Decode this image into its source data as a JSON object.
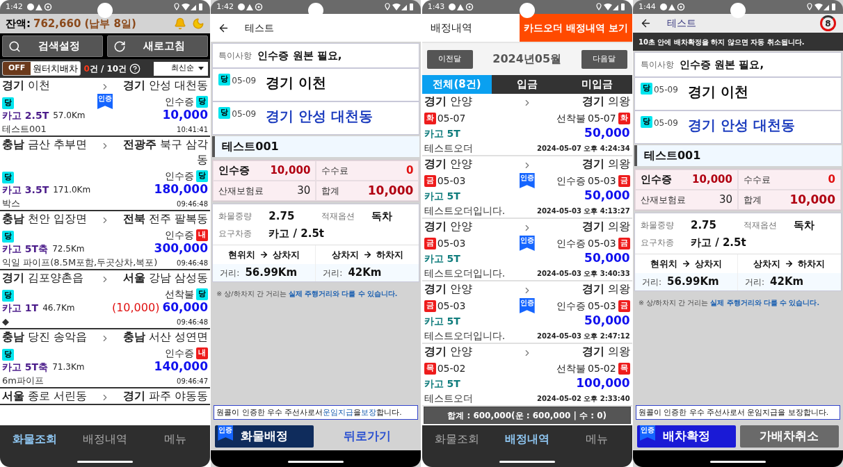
{
  "cargo_list": {
    "status_time": "1:42",
    "balance_label": "잔액:",
    "balance_value": "762,660 (납부 8일)",
    "buttons": [
      {
        "kind": "search",
        "label": "검색설정"
      },
      {
        "kind": "refresh",
        "label": "새로고침"
      }
    ],
    "auto_toggle": {
      "on": false,
      "state_label": "OFF",
      "label": "원터치배차"
    },
    "count": {
      "current": "0",
      "rest": "건 / 10건"
    },
    "sort": "최신순",
    "items": [
      {
        "from_region": "경기",
        "from_place": "이천",
        "to_region": "경기",
        "to_place": "안성 대천동",
        "left_badge": {
          "text": "당",
          "color": "#00e5ee"
        },
        "cert": "인증",
        "pay_type": "인수증",
        "right_badge": {
          "text": "당",
          "color": "#00e5ee"
        },
        "vehicle": "카고 2.5T",
        "distance": "57.0Km",
        "price": "10,000",
        "memo": "테스트001",
        "time": "10:41:41"
      },
      {
        "from_region": "충남",
        "from_place": "금산 추부면",
        "to_region": "전광주",
        "to_place": "북구 삼각동",
        "left_badge": {
          "text": "당",
          "color": "#00e5ee"
        },
        "pay_type": "인수증",
        "right_badge": {
          "text": "당",
          "color": "#00e5ee"
        },
        "vehicle": "카고 3.5T",
        "distance": "171.0Km",
        "price": "180,000",
        "memo": "박스",
        "time": "09:46:48"
      },
      {
        "from_region": "충남",
        "from_place": "천안 입장면",
        "to_region": "전북",
        "to_place": "전주 팔복동",
        "left_badge": {
          "text": "당",
          "color": "#00e5ee"
        },
        "pay_type": "인수증",
        "right_badge": {
          "text": "내",
          "color": "#ee1c1c"
        },
        "vehicle": "카고 5T축",
        "distance": "72.5Km",
        "price": "300,000",
        "memo": "익일 파이프(8.5M포함,두곳상차,복포)",
        "time": "09:46:48"
      },
      {
        "from_region": "경기",
        "from_place": "김포양촌읍",
        "to_region": "서울",
        "to_place": "강남 삼성동",
        "left_badge": {
          "text": "당",
          "color": "#00e5ee"
        },
        "pay_type": "선착불",
        "right_badge": {
          "text": "당",
          "color": "#00e5ee"
        },
        "vehicle": "카고 1T",
        "distance": "46.7Km",
        "fee": "(10,000)",
        "price": "60,000",
        "memo": "◆",
        "time": "09:46:48"
      },
      {
        "from_region": "충남",
        "from_place": "당진 송악읍",
        "to_region": "충남",
        "to_place": "서산 성연면",
        "left_badge": {
          "text": "당",
          "color": "#00e5ee"
        },
        "pay_type": "인수증",
        "right_badge": {
          "text": "내",
          "color": "#ee1c1c"
        },
        "vehicle": "카고 5T축",
        "distance": "71.3Km",
        "price": "140,000",
        "memo": "6m파이프",
        "time": "09:46:47"
      },
      {
        "from_region": "서울",
        "from_place": "종로 서린동",
        "to_region": "경기",
        "to_place": "파주 야동동"
      }
    ],
    "nav": [
      {
        "label": "화물조회",
        "selected": true
      },
      {
        "label": "배정내역",
        "selected": false
      },
      {
        "label": "메뉴",
        "selected": false
      }
    ]
  },
  "detail": {
    "status_time": "1:42",
    "title": "테스트",
    "special_label": "특이사항",
    "special_value": "인수증 원본 필요,",
    "stops": [
      {
        "kind": "pickup",
        "badge": {
          "text": "당",
          "color": "#00e5ee"
        },
        "date": "05-09",
        "place": "경기 이천"
      },
      {
        "kind": "dropoff",
        "badge": {
          "text": "당",
          "color": "#00e5ee"
        },
        "date": "05-09",
        "place": "경기 안성 대천동"
      }
    ],
    "cargo_name": "테스트001",
    "fees": [
      {
        "kind": "fare",
        "label": "인수증",
        "value": "10,000"
      },
      {
        "kind": "commission",
        "label": "수수료",
        "value": "0"
      },
      {
        "kind": "insurance",
        "label": "산재보험료",
        "value": "30"
      },
      {
        "kind": "total",
        "label": "합계",
        "value": "10,000"
      }
    ],
    "info": [
      {
        "label": "화물중량",
        "value": "2.75"
      },
      {
        "label": "적재옵션",
        "value": "독차"
      },
      {
        "label": "요구차종",
        "value": "카고 / 2.5t"
      }
    ],
    "routes": [
      {
        "from": "현위치",
        "to": "상차지",
        "distance_label": "거리:",
        "distance": "56.99Km"
      },
      {
        "from": "상차지",
        "to": "하차지",
        "distance_label": "거리:",
        "distance": "42Km"
      }
    ],
    "note": {
      "text": "※ 상/하차지 간 거리는",
      "highlight": "실제 주행거리와 다를 수 있습니다."
    },
    "guarantee": [
      {
        "text": "원콜이 인증한 우수 주선사로서 ",
        "highlight": false
      },
      {
        "text": "운임지급",
        "highlight": true
      },
      {
        "text": "을 ",
        "highlight": false
      },
      {
        "text": "보장",
        "highlight": true
      },
      {
        "text": "합니다.",
        "highlight": false
      }
    ],
    "buttons": [
      {
        "kind": "assign",
        "label": "화물배정",
        "cert": "인증"
      },
      {
        "kind": "text",
        "label": "뒤로가기"
      }
    ]
  },
  "assignments": {
    "status_time": "1:43",
    "title": "배정내역",
    "card_button": "카드오더 배정내역 보기",
    "prev": "이전달",
    "month": "2024년05월",
    "next": "다음달",
    "tabs": [
      {
        "label": "전체(8건)",
        "selected": true
      },
      {
        "label": "입금",
        "selected": false
      },
      {
        "label": "미입금",
        "selected": false
      }
    ],
    "items": [
      {
        "from_region": "경기",
        "from_place": "안양",
        "to_region": "경기",
        "to_place": "의왕",
        "left_badge": {
          "text": "화",
          "color": "#ee1c1c"
        },
        "date": "05-07",
        "pay_type": "선착불",
        "right_date": "05-07",
        "right_badge": {
          "text": "화",
          "color": "#ee1c1c"
        },
        "vehicle": "카고 5T",
        "price": "50,000",
        "memo": "테스트오더",
        "time": "2024-05-07 오후 4:24:34"
      },
      {
        "from_region": "경기",
        "from_place": "안양",
        "to_region": "경기",
        "to_place": "의왕",
        "left_badge": {
          "text": "금",
          "color": "#ee1c1c"
        },
        "date": "05-03",
        "cert": "인증",
        "pay_type": "인수증",
        "right_date": "05-03",
        "right_badge": {
          "text": "금",
          "color": "#ee1c1c"
        },
        "vehicle": "카고 5T",
        "price": "50,000",
        "memo": "테스트오더입니다.",
        "time": "2024-05-03 오후 4:13:27"
      },
      {
        "from_region": "경기",
        "from_place": "안양",
        "to_region": "경기",
        "to_place": "의왕",
        "left_badge": {
          "text": "금",
          "color": "#ee1c1c"
        },
        "date": "05-03",
        "cert": "인증",
        "pay_type": "인수증",
        "right_date": "05-03",
        "right_badge": {
          "text": "금",
          "color": "#ee1c1c"
        },
        "vehicle": "카고 5T",
        "price": "50,000",
        "memo": "테스트오더입니다.",
        "time": "2024-05-03 오후 3:40:33"
      },
      {
        "from_region": "경기",
        "from_place": "안양",
        "to_region": "경기",
        "to_place": "의왕",
        "left_badge": {
          "text": "금",
          "color": "#ee1c1c"
        },
        "date": "05-03",
        "cert": "인증",
        "pay_type": "인수증",
        "right_date": "05-03",
        "right_badge": {
          "text": "금",
          "color": "#ee1c1c"
        },
        "vehicle": "카고 5T",
        "price": "50,000",
        "memo": "테스트오더입니다.",
        "time": "2024-05-03 오후 2:47:12"
      },
      {
        "from_region": "경기",
        "from_place": "안양",
        "to_region": "경기",
        "to_place": "의왕",
        "left_badge": {
          "text": "목",
          "color": "#ee1c1c"
        },
        "date": "05-02",
        "pay_type": "선착불",
        "right_date": "05-02",
        "right_badge": {
          "text": "목",
          "color": "#ee1c1c"
        },
        "vehicle": "카고 5T",
        "price": "100,000",
        "memo": "테스트오더",
        "time": "2024-05-02 오후 2:33:40"
      }
    ],
    "total": "합계 : 600,000(운 : 600,000 | 수 : 0)",
    "nav": [
      {
        "label": "화물조회",
        "selected": false
      },
      {
        "label": "배정내역",
        "selected": true
      },
      {
        "label": "메뉴",
        "selected": false
      }
    ]
  },
  "confirm": {
    "status_time": "1:44",
    "title": "테스트",
    "countdown": "8",
    "notice": "10초 안에 배차확정을 하지 않으면 자동 취소됩니다.",
    "special_label": "특이사항",
    "special_value": "인수증 원본 필요,",
    "stops": [
      {
        "kind": "pickup",
        "badge": {
          "text": "당",
          "color": "#00e5ee"
        },
        "date": "05-09",
        "place": "경기 이천"
      },
      {
        "kind": "dropoff",
        "badge": {
          "text": "당",
          "color": "#00e5ee"
        },
        "date": "05-09",
        "place": "경기 안성 대천동"
      }
    ],
    "cargo_name": "테스트001",
    "fees": [
      {
        "kind": "fare",
        "label": "인수증",
        "value": "10,000"
      },
      {
        "kind": "commission",
        "label": "수수료",
        "value": "0"
      },
      {
        "kind": "insurance",
        "label": "산재보험료",
        "value": "30"
      },
      {
        "kind": "total",
        "label": "합계",
        "value": "10,000"
      }
    ],
    "info": [
      {
        "label": "화물중량",
        "value": "2.75"
      },
      {
        "label": "적재옵션",
        "value": "독차"
      },
      {
        "label": "요구차종",
        "value": "카고 / 2.5t"
      }
    ],
    "routes": [
      {
        "from": "현위치",
        "to": "상차지",
        "distance_label": "거리:",
        "distance": "56.99Km"
      },
      {
        "from": "상차지",
        "to": "하차지",
        "distance_label": "거리:",
        "distance": "42Km"
      }
    ],
    "note": {
      "text": "※ 상/하차지 간 거리는",
      "highlight": "실제 주행거리와 다를 수 있습니다."
    },
    "guarantee": [
      {
        "text": "원콜이 인증한 우수 주선사로서 운임지급을 보장합니다.",
        "highlight": false
      }
    ],
    "buttons": [
      {
        "kind": "confirm",
        "label": "배차확정",
        "cert": "인증"
      },
      {
        "kind": "cancel",
        "label": "가배차취소"
      }
    ]
  }
}
